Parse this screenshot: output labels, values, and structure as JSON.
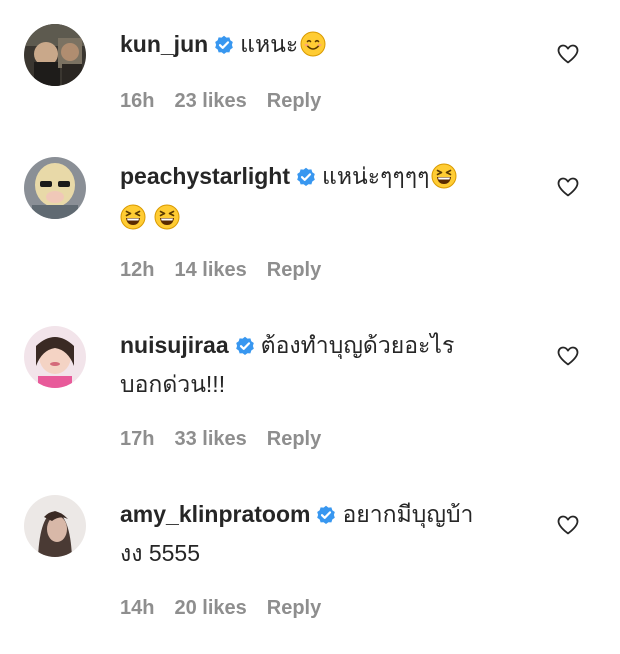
{
  "comments": [
    {
      "username": "kun_jun",
      "text": "แหนะ",
      "emoji": [
        "smiling-face-emoji"
      ],
      "time": "16h",
      "likes": "23 likes",
      "reply": "Reply"
    },
    {
      "username": "peachystarlight",
      "text": "แหน่ะๆๆๆๆ",
      "emoji": [
        "grinning-squinting-face-emoji",
        "grinning-squinting-face-emoji",
        "grinning-squinting-face-emoji"
      ],
      "time": "12h",
      "likes": "14 likes",
      "reply": "Reply"
    },
    {
      "username": "nuisujiraa",
      "text_line1": "ต้องทำบุญด้วยอะไร",
      "text_line2": "บอกด่วน!!!",
      "time": "17h",
      "likes": "33 likes",
      "reply": "Reply"
    },
    {
      "username": "amy_klinpratoom",
      "text_line1": "อยากมีบุญบ้า",
      "text_line2": "งง 5555",
      "time": "14h",
      "likes": "20 likes",
      "reply": "Reply"
    }
  ],
  "colors": {
    "verified": "#3897f0",
    "meta": "#8e8e8e",
    "text": "#262626",
    "emoji_face": "#ffcc33"
  },
  "icons": [
    "verified-badge-icon",
    "heart-outline-icon",
    "avatar"
  ]
}
